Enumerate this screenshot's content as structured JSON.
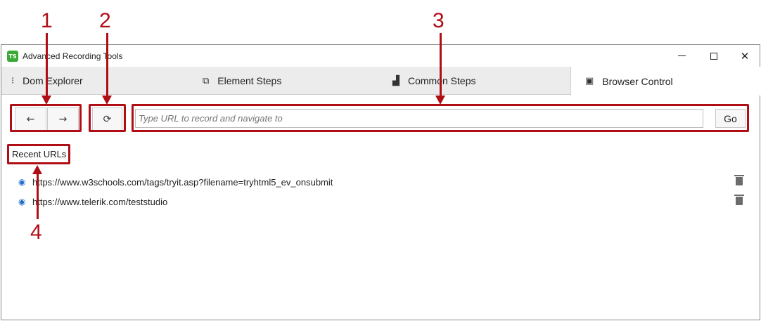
{
  "window": {
    "title": "Advanced Recording Tools",
    "logo_text": "TS",
    "controls": {
      "minimize": "–",
      "maximize": "□",
      "close": "✕"
    }
  },
  "tabs": [
    {
      "label": "Dom Explorer",
      "icon": "⁝"
    },
    {
      "label": "Element Steps",
      "icon": "⧉"
    },
    {
      "label": "Common Steps",
      "icon": "▟"
    },
    {
      "label": "Browser Control",
      "icon": "▣"
    }
  ],
  "toolbar": {
    "back_label": "←",
    "forward_label": "→",
    "refresh_label": "⟳",
    "url_placeholder": "Type URL to record and navigate to",
    "url_value": "",
    "go_label": "Go"
  },
  "recent": {
    "label": "Recent URLs",
    "urls": [
      "https://www.w3schools.com/tags/tryit.asp?filename=tryhtml5_ev_onsubmit",
      "https://www.telerik.com/teststudio"
    ]
  },
  "annotations": [
    "1",
    "2",
    "3",
    "4"
  ],
  "colors": {
    "annotation": "#b00d15",
    "active_tab": "#ffffff",
    "tabstrip": "#ececec",
    "logo": "#3aa935"
  }
}
